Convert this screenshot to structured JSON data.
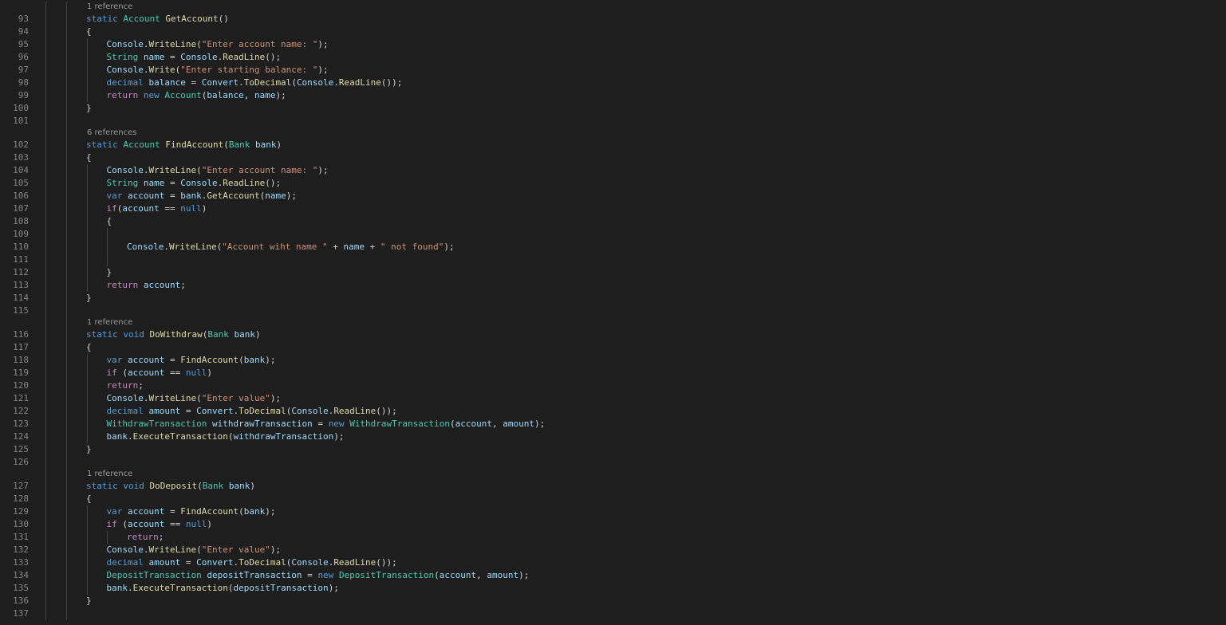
{
  "colors": {
    "background": "#1e1e1e",
    "line_number": "#858585",
    "codelens": "#999999",
    "indent_guide": "#404040",
    "plain": "#d4d4d4",
    "keyword": "#569cd6",
    "control_keyword": "#c586c0",
    "type": "#4ec9b0",
    "method": "#dcdcaa",
    "variable": "#9cdcfe",
    "string": "#ce9178"
  },
  "token_kinds": {
    "p": "plain",
    "k": "keyword",
    "c": "control_keyword",
    "t": "type",
    "m": "method",
    "v": "variable",
    "s": "string"
  },
  "lines": [
    {
      "kind": "codelens",
      "text": "1 reference"
    },
    {
      "kind": "code",
      "num": "93",
      "indent": 0,
      "tokens": [
        [
          "static ",
          "k"
        ],
        [
          "Account",
          "t"
        ],
        [
          " ",
          "p"
        ],
        [
          "GetAccount",
          "m"
        ],
        [
          "()",
          "p"
        ]
      ]
    },
    {
      "kind": "code",
      "num": "94",
      "indent": 0,
      "tokens": [
        [
          "{",
          "p"
        ]
      ]
    },
    {
      "kind": "code",
      "num": "95",
      "indent": 1,
      "tokens": [
        [
          "Console",
          "v"
        ],
        [
          ".",
          "p"
        ],
        [
          "WriteLine",
          "m"
        ],
        [
          "(",
          "p"
        ],
        [
          "\"Enter account name: \"",
          "s"
        ],
        [
          ");",
          "p"
        ]
      ]
    },
    {
      "kind": "code",
      "num": "96",
      "indent": 1,
      "tokens": [
        [
          "String",
          "t"
        ],
        [
          " ",
          "p"
        ],
        [
          "name",
          "v"
        ],
        [
          " = ",
          "p"
        ],
        [
          "Console",
          "v"
        ],
        [
          ".",
          "p"
        ],
        [
          "ReadLine",
          "m"
        ],
        [
          "();",
          "p"
        ]
      ]
    },
    {
      "kind": "code",
      "num": "97",
      "indent": 1,
      "tokens": [
        [
          "Console",
          "v"
        ],
        [
          ".",
          "p"
        ],
        [
          "Write",
          "m"
        ],
        [
          "(",
          "p"
        ],
        [
          "\"Enter starting balance: \"",
          "s"
        ],
        [
          ");",
          "p"
        ]
      ]
    },
    {
      "kind": "code",
      "num": "98",
      "indent": 1,
      "tokens": [
        [
          "decimal",
          "k"
        ],
        [
          " ",
          "p"
        ],
        [
          "balance",
          "v"
        ],
        [
          " = ",
          "p"
        ],
        [
          "Convert",
          "v"
        ],
        [
          ".",
          "p"
        ],
        [
          "ToDecimal",
          "m"
        ],
        [
          "(",
          "p"
        ],
        [
          "Console",
          "v"
        ],
        [
          ".",
          "p"
        ],
        [
          "ReadLine",
          "m"
        ],
        [
          "());",
          "p"
        ]
      ]
    },
    {
      "kind": "code",
      "num": "99",
      "indent": 1,
      "tokens": [
        [
          "return",
          "c"
        ],
        [
          " ",
          "p"
        ],
        [
          "new",
          "k"
        ],
        [
          " ",
          "p"
        ],
        [
          "Account",
          "t"
        ],
        [
          "(",
          "p"
        ],
        [
          "balance",
          "v"
        ],
        [
          ", ",
          "p"
        ],
        [
          "name",
          "v"
        ],
        [
          ");",
          "p"
        ]
      ]
    },
    {
      "kind": "code",
      "num": "100",
      "indent": 0,
      "tokens": [
        [
          "}",
          "p"
        ]
      ]
    },
    {
      "kind": "code",
      "num": "101",
      "indent": 0,
      "tokens": []
    },
    {
      "kind": "codelens",
      "text": "6 references"
    },
    {
      "kind": "code",
      "num": "102",
      "indent": 0,
      "tokens": [
        [
          "static ",
          "k"
        ],
        [
          "Account",
          "t"
        ],
        [
          " ",
          "p"
        ],
        [
          "FindAccount",
          "m"
        ],
        [
          "(",
          "p"
        ],
        [
          "Bank",
          "t"
        ],
        [
          " ",
          "p"
        ],
        [
          "bank",
          "v"
        ],
        [
          ")",
          "p"
        ]
      ]
    },
    {
      "kind": "code",
      "num": "103",
      "indent": 0,
      "tokens": [
        [
          "{",
          "p"
        ]
      ]
    },
    {
      "kind": "code",
      "num": "104",
      "indent": 1,
      "tokens": [
        [
          "Console",
          "v"
        ],
        [
          ".",
          "p"
        ],
        [
          "WriteLine",
          "m"
        ],
        [
          "(",
          "p"
        ],
        [
          "\"Enter account name: \"",
          "s"
        ],
        [
          ");",
          "p"
        ]
      ]
    },
    {
      "kind": "code",
      "num": "105",
      "indent": 1,
      "tokens": [
        [
          "String",
          "t"
        ],
        [
          " ",
          "p"
        ],
        [
          "name",
          "v"
        ],
        [
          " = ",
          "p"
        ],
        [
          "Console",
          "v"
        ],
        [
          ".",
          "p"
        ],
        [
          "ReadLine",
          "m"
        ],
        [
          "();",
          "p"
        ]
      ]
    },
    {
      "kind": "code",
      "num": "106",
      "indent": 1,
      "tokens": [
        [
          "var",
          "k"
        ],
        [
          " ",
          "p"
        ],
        [
          "account",
          "v"
        ],
        [
          " = ",
          "p"
        ],
        [
          "bank",
          "v"
        ],
        [
          ".",
          "p"
        ],
        [
          "GetAccount",
          "m"
        ],
        [
          "(",
          "p"
        ],
        [
          "name",
          "v"
        ],
        [
          ");",
          "p"
        ]
      ]
    },
    {
      "kind": "code",
      "num": "107",
      "indent": 1,
      "tokens": [
        [
          "if",
          "c"
        ],
        [
          "(",
          "p"
        ],
        [
          "account",
          "v"
        ],
        [
          " == ",
          "p"
        ],
        [
          "null",
          "k"
        ],
        [
          ")",
          "p"
        ]
      ]
    },
    {
      "kind": "code",
      "num": "108",
      "indent": 1,
      "tokens": [
        [
          "{",
          "p"
        ]
      ]
    },
    {
      "kind": "code",
      "num": "109",
      "indent": 2,
      "tokens": []
    },
    {
      "kind": "code",
      "num": "110",
      "indent": 2,
      "tokens": [
        [
          "Console",
          "v"
        ],
        [
          ".",
          "p"
        ],
        [
          "WriteLine",
          "m"
        ],
        [
          "(",
          "p"
        ],
        [
          "\"Account wiht name \"",
          "s"
        ],
        [
          " + ",
          "p"
        ],
        [
          "name",
          "v"
        ],
        [
          " + ",
          "p"
        ],
        [
          "\" not found\"",
          "s"
        ],
        [
          ");",
          "p"
        ]
      ]
    },
    {
      "kind": "code",
      "num": "111",
      "indent": 2,
      "tokens": []
    },
    {
      "kind": "code",
      "num": "112",
      "indent": 1,
      "tokens": [
        [
          "}",
          "p"
        ]
      ]
    },
    {
      "kind": "code",
      "num": "113",
      "indent": 1,
      "tokens": [
        [
          "return",
          "c"
        ],
        [
          " ",
          "p"
        ],
        [
          "account",
          "v"
        ],
        [
          ";",
          "p"
        ]
      ]
    },
    {
      "kind": "code",
      "num": "114",
      "indent": 0,
      "tokens": [
        [
          "}",
          "p"
        ]
      ]
    },
    {
      "kind": "code",
      "num": "115",
      "indent": 0,
      "tokens": []
    },
    {
      "kind": "codelens",
      "text": "1 reference"
    },
    {
      "kind": "code",
      "num": "116",
      "indent": 0,
      "tokens": [
        [
          "static ",
          "k"
        ],
        [
          "void",
          "k"
        ],
        [
          " ",
          "p"
        ],
        [
          "DoWithdraw",
          "m"
        ],
        [
          "(",
          "p"
        ],
        [
          "Bank",
          "t"
        ],
        [
          " ",
          "p"
        ],
        [
          "bank",
          "v"
        ],
        [
          ")",
          "p"
        ]
      ]
    },
    {
      "kind": "code",
      "num": "117",
      "indent": 0,
      "tokens": [
        [
          "{",
          "p"
        ]
      ]
    },
    {
      "kind": "code",
      "num": "118",
      "indent": 1,
      "tokens": [
        [
          "var",
          "k"
        ],
        [
          " ",
          "p"
        ],
        [
          "account",
          "v"
        ],
        [
          " = ",
          "p"
        ],
        [
          "FindAccount",
          "m"
        ],
        [
          "(",
          "p"
        ],
        [
          "bank",
          "v"
        ],
        [
          ");",
          "p"
        ]
      ]
    },
    {
      "kind": "code",
      "num": "119",
      "indent": 1,
      "tokens": [
        [
          "if",
          "c"
        ],
        [
          " (",
          "p"
        ],
        [
          "account",
          "v"
        ],
        [
          " == ",
          "p"
        ],
        [
          "null",
          "k"
        ],
        [
          ")",
          "p"
        ]
      ]
    },
    {
      "kind": "code",
      "num": "120",
      "indent": 1,
      "tokens": [
        [
          "return",
          "c"
        ],
        [
          ";",
          "p"
        ]
      ]
    },
    {
      "kind": "code",
      "num": "121",
      "indent": 1,
      "tokens": [
        [
          "Console",
          "v"
        ],
        [
          ".",
          "p"
        ],
        [
          "WriteLine",
          "m"
        ],
        [
          "(",
          "p"
        ],
        [
          "\"Enter value\"",
          "s"
        ],
        [
          ");",
          "p"
        ]
      ]
    },
    {
      "kind": "code",
      "num": "122",
      "indent": 1,
      "tokens": [
        [
          "decimal",
          "k"
        ],
        [
          " ",
          "p"
        ],
        [
          "amount",
          "v"
        ],
        [
          " = ",
          "p"
        ],
        [
          "Convert",
          "v"
        ],
        [
          ".",
          "p"
        ],
        [
          "ToDecimal",
          "m"
        ],
        [
          "(",
          "p"
        ],
        [
          "Console",
          "v"
        ],
        [
          ".",
          "p"
        ],
        [
          "ReadLine",
          "m"
        ],
        [
          "());",
          "p"
        ]
      ]
    },
    {
      "kind": "code",
      "num": "123",
      "indent": 1,
      "tokens": [
        [
          "WithdrawTransaction",
          "t"
        ],
        [
          " ",
          "p"
        ],
        [
          "withdrawTransaction",
          "v"
        ],
        [
          " = ",
          "p"
        ],
        [
          "new",
          "k"
        ],
        [
          " ",
          "p"
        ],
        [
          "WithdrawTransaction",
          "t"
        ],
        [
          "(",
          "p"
        ],
        [
          "account",
          "v"
        ],
        [
          ", ",
          "p"
        ],
        [
          "amount",
          "v"
        ],
        [
          ");",
          "p"
        ]
      ]
    },
    {
      "kind": "code",
      "num": "124",
      "indent": 1,
      "tokens": [
        [
          "bank",
          "v"
        ],
        [
          ".",
          "p"
        ],
        [
          "ExecuteTransaction",
          "m"
        ],
        [
          "(",
          "p"
        ],
        [
          "withdrawTransaction",
          "v"
        ],
        [
          ");",
          "p"
        ]
      ]
    },
    {
      "kind": "code",
      "num": "125",
      "indent": 0,
      "tokens": [
        [
          "}",
          "p"
        ]
      ]
    },
    {
      "kind": "code",
      "num": "126",
      "indent": 0,
      "tokens": []
    },
    {
      "kind": "codelens",
      "text": "1 reference"
    },
    {
      "kind": "code",
      "num": "127",
      "indent": 0,
      "tokens": [
        [
          "static ",
          "k"
        ],
        [
          "void",
          "k"
        ],
        [
          " ",
          "p"
        ],
        [
          "DoDeposit",
          "m"
        ],
        [
          "(",
          "p"
        ],
        [
          "Bank",
          "t"
        ],
        [
          " ",
          "p"
        ],
        [
          "bank",
          "v"
        ],
        [
          ")",
          "p"
        ]
      ]
    },
    {
      "kind": "code",
      "num": "128",
      "indent": 0,
      "tokens": [
        [
          "{",
          "p"
        ]
      ]
    },
    {
      "kind": "code",
      "num": "129",
      "indent": 1,
      "tokens": [
        [
          "var",
          "k"
        ],
        [
          " ",
          "p"
        ],
        [
          "account",
          "v"
        ],
        [
          " = ",
          "p"
        ],
        [
          "FindAccount",
          "m"
        ],
        [
          "(",
          "p"
        ],
        [
          "bank",
          "v"
        ],
        [
          ");",
          "p"
        ]
      ]
    },
    {
      "kind": "code",
      "num": "130",
      "indent": 1,
      "tokens": [
        [
          "if",
          "c"
        ],
        [
          " (",
          "p"
        ],
        [
          "account",
          "v"
        ],
        [
          " == ",
          "p"
        ],
        [
          "null",
          "k"
        ],
        [
          ")",
          "p"
        ]
      ]
    },
    {
      "kind": "code",
      "num": "131",
      "indent": 2,
      "tokens": [
        [
          "return",
          "c"
        ],
        [
          ";",
          "p"
        ]
      ]
    },
    {
      "kind": "code",
      "num": "132",
      "indent": 1,
      "tokens": [
        [
          "Console",
          "v"
        ],
        [
          ".",
          "p"
        ],
        [
          "WriteLine",
          "m"
        ],
        [
          "(",
          "p"
        ],
        [
          "\"Enter value\"",
          "s"
        ],
        [
          ");",
          "p"
        ]
      ]
    },
    {
      "kind": "code",
      "num": "133",
      "indent": 1,
      "tokens": [
        [
          "decimal",
          "k"
        ],
        [
          " ",
          "p"
        ],
        [
          "amount",
          "v"
        ],
        [
          " = ",
          "p"
        ],
        [
          "Convert",
          "v"
        ],
        [
          ".",
          "p"
        ],
        [
          "ToDecimal",
          "m"
        ],
        [
          "(",
          "p"
        ],
        [
          "Console",
          "v"
        ],
        [
          ".",
          "p"
        ],
        [
          "ReadLine",
          "m"
        ],
        [
          "());",
          "p"
        ]
      ]
    },
    {
      "kind": "code",
      "num": "134",
      "indent": 1,
      "tokens": [
        [
          "DepositTransaction",
          "t"
        ],
        [
          " ",
          "p"
        ],
        [
          "depositTransaction",
          "v"
        ],
        [
          " = ",
          "p"
        ],
        [
          "new",
          "k"
        ],
        [
          " ",
          "p"
        ],
        [
          "DepositTransaction",
          "t"
        ],
        [
          "(",
          "p"
        ],
        [
          "account",
          "v"
        ],
        [
          ", ",
          "p"
        ],
        [
          "amount",
          "v"
        ],
        [
          ");",
          "p"
        ]
      ]
    },
    {
      "kind": "code",
      "num": "135",
      "indent": 1,
      "tokens": [
        [
          "bank",
          "v"
        ],
        [
          ".",
          "p"
        ],
        [
          "ExecuteTransaction",
          "m"
        ],
        [
          "(",
          "p"
        ],
        [
          "depositTransaction",
          "v"
        ],
        [
          ");",
          "p"
        ]
      ]
    },
    {
      "kind": "code",
      "num": "136",
      "indent": 0,
      "tokens": [
        [
          "}",
          "p"
        ]
      ]
    },
    {
      "kind": "code",
      "num": "137",
      "indent": 0,
      "tokens": []
    }
  ]
}
